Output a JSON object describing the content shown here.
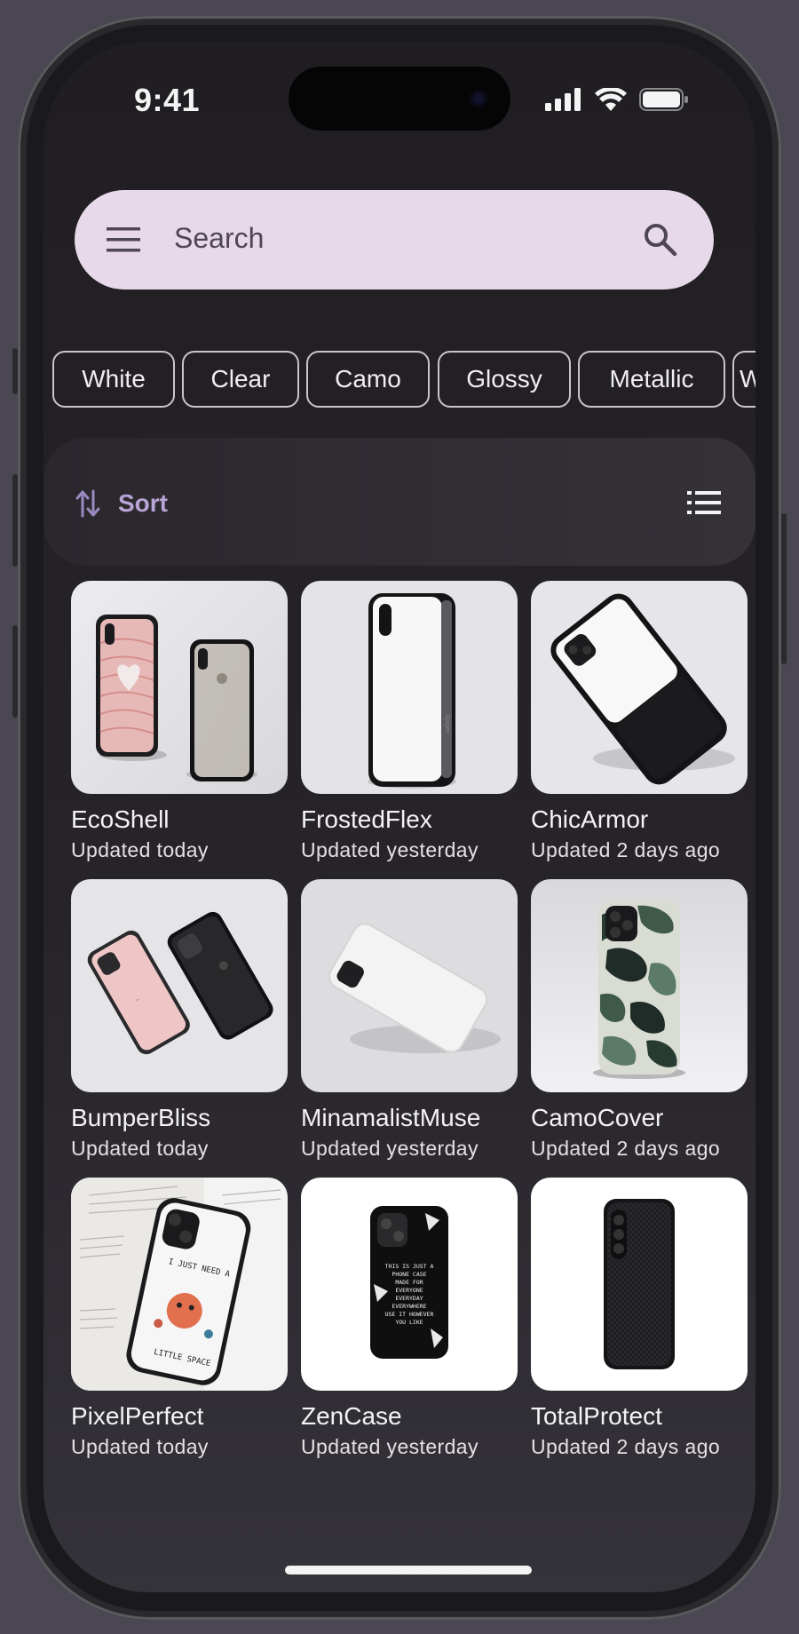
{
  "status_bar": {
    "time": "9:41"
  },
  "search": {
    "placeholder": "Search"
  },
  "chips": [
    "White",
    "Clear",
    "Camo",
    "Glossy",
    "Metallic",
    "Wood"
  ],
  "sort": {
    "label": "Sort"
  },
  "products": [
    {
      "name": "EcoShell",
      "updated": "Updated today"
    },
    {
      "name": "FrostedFlex",
      "updated": "Updated yesterday"
    },
    {
      "name": "ChicArmor",
      "updated": "Updated 2 days ago"
    },
    {
      "name": "BumperBliss",
      "updated": "Updated today"
    },
    {
      "name": "MinamalistMuse",
      "updated": "Updated yesterday"
    },
    {
      "name": "CamoCover",
      "updated": "Updated 2 days ago"
    },
    {
      "name": "PixelPerfect",
      "updated": "Updated today"
    },
    {
      "name": "ZenCase",
      "updated": "Updated yesterday"
    },
    {
      "name": "TotalProtect",
      "updated": "Updated 2 days ago"
    }
  ],
  "case_texts": {
    "pixelperfect": [
      "I JUST NEED A",
      "LITTLE SPACE"
    ],
    "zencase": [
      "THIS IS JUST A",
      "PHONE CASE",
      "MADE FOR",
      "EVERYONE",
      "EVERYDAY",
      "EVERYWHERE",
      "USE IT HOWEVER",
      "YOU LIKE"
    ]
  },
  "icons": {
    "menu": "menu-icon",
    "search": "search-icon",
    "sort": "sort-icon",
    "list": "list-view-icon",
    "signal": "signal-icon",
    "wifi": "wifi-icon",
    "battery": "battery-icon"
  },
  "colors": {
    "search_bg": "#e8d9ea",
    "accent": "#b8a4d6",
    "screen_bg": "#201e22"
  }
}
